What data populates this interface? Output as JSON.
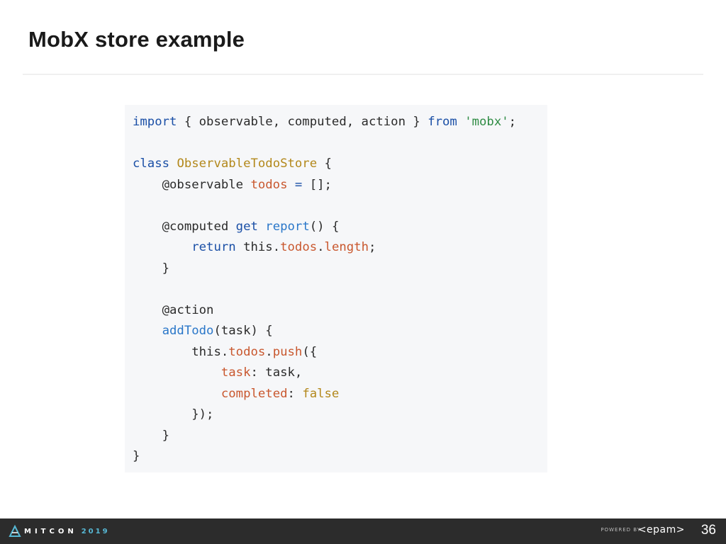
{
  "slide": {
    "title": "MobX store example",
    "page_number": "36"
  },
  "code": {
    "lines": [
      [
        {
          "t": "import",
          "c": "kw"
        },
        {
          "t": " { observable, computed, action } ",
          "c": "op"
        },
        {
          "t": "from",
          "c": "kw"
        },
        {
          "t": " ",
          "c": "op"
        },
        {
          "t": "'mobx'",
          "c": "str"
        },
        {
          "t": ";",
          "c": "op"
        }
      ],
      [],
      [
        {
          "t": "class",
          "c": "kw"
        },
        {
          "t": " ",
          "c": "op"
        },
        {
          "t": "ObservableTodoStore",
          "c": "cls"
        },
        {
          "t": " {",
          "c": "op"
        }
      ],
      [
        {
          "t": "    @observable ",
          "c": "dec"
        },
        {
          "t": "todos",
          "c": "prop"
        },
        {
          "t": " ",
          "c": "op"
        },
        {
          "t": "=",
          "c": "kw"
        },
        {
          "t": " [];",
          "c": "op"
        }
      ],
      [],
      [
        {
          "t": "    @computed ",
          "c": "dec"
        },
        {
          "t": "get",
          "c": "kw"
        },
        {
          "t": " ",
          "c": "op"
        },
        {
          "t": "report",
          "c": "fn"
        },
        {
          "t": "() {",
          "c": "op"
        }
      ],
      [
        {
          "t": "        ",
          "c": "op"
        },
        {
          "t": "return",
          "c": "kw"
        },
        {
          "t": " this.",
          "c": "op"
        },
        {
          "t": "todos",
          "c": "prop"
        },
        {
          "t": ".",
          "c": "op"
        },
        {
          "t": "length",
          "c": "prop"
        },
        {
          "t": ";",
          "c": "op"
        }
      ],
      [
        {
          "t": "    }",
          "c": "op"
        }
      ],
      [],
      [
        {
          "t": "    @action",
          "c": "dec"
        }
      ],
      [
        {
          "t": "    ",
          "c": "op"
        },
        {
          "t": "addTodo",
          "c": "fn"
        },
        {
          "t": "(task) {",
          "c": "op"
        }
      ],
      [
        {
          "t": "        this.",
          "c": "op"
        },
        {
          "t": "todos",
          "c": "prop"
        },
        {
          "t": ".",
          "c": "op"
        },
        {
          "t": "push",
          "c": "prop"
        },
        {
          "t": "({",
          "c": "op"
        }
      ],
      [
        {
          "t": "            ",
          "c": "op"
        },
        {
          "t": "task",
          "c": "prop"
        },
        {
          "t": ": task,",
          "c": "op"
        }
      ],
      [
        {
          "t": "            ",
          "c": "op"
        },
        {
          "t": "completed",
          "c": "prop"
        },
        {
          "t": ": ",
          "c": "op"
        },
        {
          "t": "false",
          "c": "val"
        }
      ],
      [
        {
          "t": "        });",
          "c": "op"
        }
      ],
      [
        {
          "t": "    }",
          "c": "op"
        }
      ],
      [
        {
          "t": "}",
          "c": "op"
        }
      ]
    ]
  },
  "footer": {
    "conference_name": "MITCON",
    "conference_year": "2019",
    "powered_by": "POWERED BY",
    "sponsor_logo": "<epam>"
  },
  "colors": {
    "footer_bg": "#2c2c2c",
    "code_bg": "#f6f7f9",
    "keyword": "#1a4fa6",
    "class_name": "#b3881b",
    "string": "#2f8c44",
    "property": "#c9582f",
    "function": "#2a77c9",
    "accent": "#57b9d6"
  }
}
